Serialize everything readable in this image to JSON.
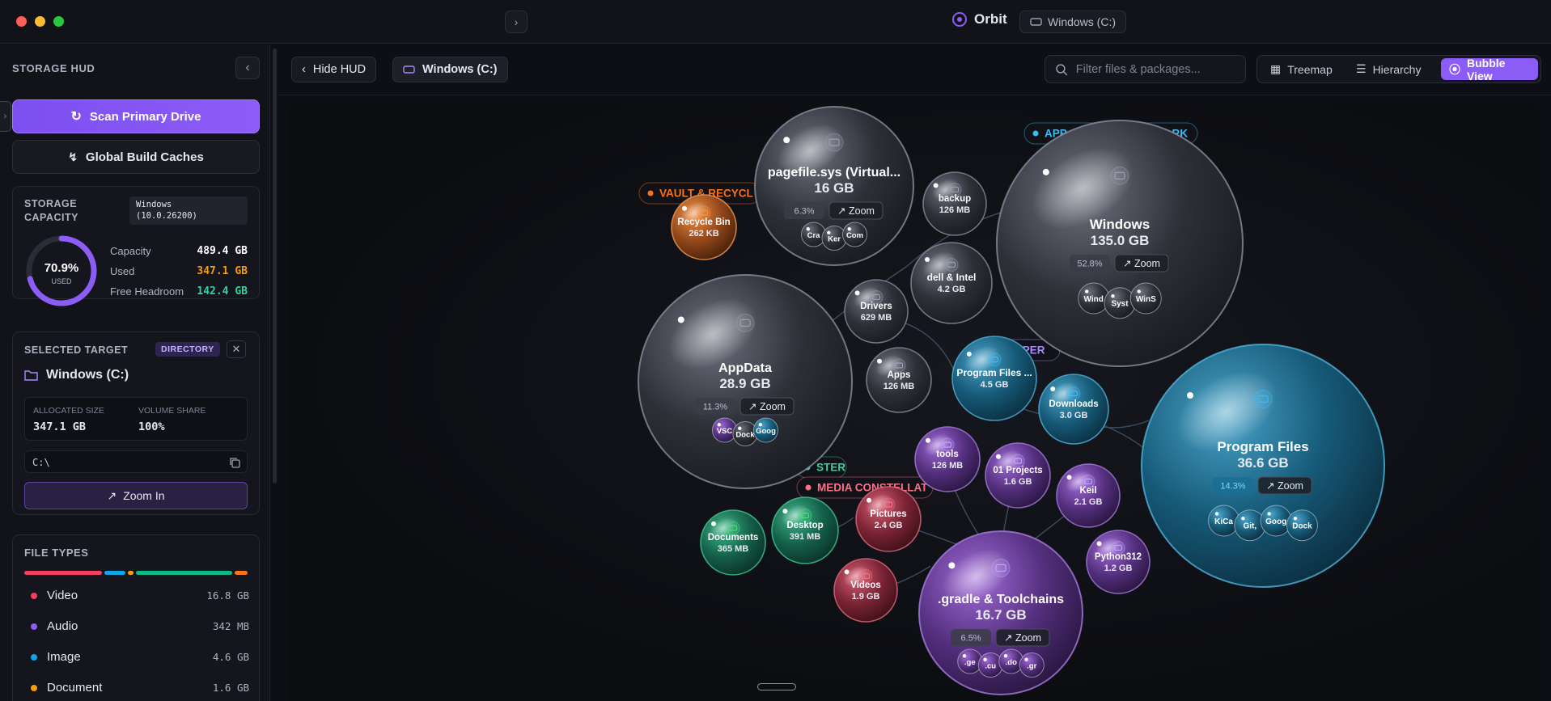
{
  "window": {
    "app_name": "Orbit",
    "drive_chip": "Windows (C:)"
  },
  "sidebar": {
    "title": "STORAGE HUD",
    "scan_button": "Scan Primary Drive",
    "caches_button": "Global Build Caches",
    "capacity_card": {
      "label": "STORAGE CAPACITY",
      "os_badge_line1": "Windows",
      "os_badge_line2": "(10.0.26200)",
      "gauge_value": "70.9%",
      "gauge_caption": "USED",
      "gauge_fraction": 0.709,
      "rows": [
        {
          "label": "Capacity",
          "value": "489.4 GB",
          "color": "#ffffff"
        },
        {
          "label": "Used",
          "value": "347.1 GB",
          "color": "#f59e0b"
        },
        {
          "label": "Free Headroom",
          "value": "142.4 GB",
          "color": "#34d399"
        }
      ]
    },
    "selected": {
      "label": "SELECTED TARGET",
      "badge": "DIRECTORY",
      "name": "Windows (C:)",
      "alloc_label": "ALLOCATED SIZE",
      "alloc_value": "347.1 GB",
      "share_label": "VOLUME SHARE",
      "share_value": "100%",
      "path": "C:\\",
      "zoom_button": "Zoom In"
    },
    "file_types": {
      "label": "FILE TYPES",
      "items": [
        {
          "name": "Video",
          "size": "16.8 GB",
          "color": "#f43f5e"
        },
        {
          "name": "Audio",
          "size": "342 MB",
          "color": "#8b5cf6"
        },
        {
          "name": "Image",
          "size": "4.6 GB",
          "color": "#0ea5e9"
        },
        {
          "name": "Document",
          "size": "1.6 GB",
          "color": "#f59e0b"
        }
      ]
    }
  },
  "toolbar": {
    "hide_hud": "Hide HUD",
    "crumb": "Windows (C:)",
    "search_placeholder": "Filter files & packages...",
    "views": [
      "Treemap",
      "Hierarchy",
      "Bubble View"
    ],
    "active_view": "Bubble View"
  },
  "clusters": [
    {
      "text": "VAULT & RECYCL",
      "color": "#f97316"
    },
    {
      "text": "APP",
      "suffix": "RK",
      "color": "#38bdf8"
    },
    {
      "text": "LOPER",
      "color": "#a78bfa"
    },
    {
      "text": "STER",
      "color": "#34d399"
    },
    {
      "text": "MEDIA CONSTELLAT",
      "color": "#fb7185"
    }
  ],
  "bubbles": [
    {
      "name": "pagefile.sys (Virtual...",
      "size": "16 GB",
      "share": "6.3%",
      "zoom": "Zoom",
      "children": [
        "Cra",
        "Ker",
        "Com"
      ],
      "theme": "gray"
    },
    {
      "name": "Windows",
      "size": "135.0 GB",
      "share": "52.8%",
      "zoom": "Zoom",
      "children": [
        "Wind",
        "Syst",
        "WinS"
      ],
      "theme": "gray"
    },
    {
      "name": "AppData",
      "size": "28.9 GB",
      "share": "11.3%",
      "zoom": "Zoom",
      "children": [
        "VSC",
        "Dock",
        "Goog"
      ],
      "theme": "gray"
    },
    {
      "name": "Program Files",
      "size": "36.6 GB",
      "share": "14.3%",
      "zoom": "Zoom",
      "children": [
        "KiCa",
        "Git,",
        "Goog",
        "Dock"
      ],
      "theme": "blue"
    },
    {
      "name": ".gradle & Toolchains",
      "size": "16.7 GB",
      "share": "6.5%",
      "zoom": "Zoom",
      "children": [
        ".ge",
        ".cu",
        ".do",
        ".gr"
      ],
      "theme": "purple"
    },
    {
      "name": "Recycle Bin",
      "size": "262 KB",
      "theme": "orange"
    },
    {
      "name": "backup",
      "size": "126 MB",
      "theme": "gray"
    },
    {
      "name": "dell & Intel",
      "size": "4.2 GB",
      "theme": "gray"
    },
    {
      "name": "Drivers",
      "size": "629 MB",
      "theme": "gray"
    },
    {
      "name": "Apps",
      "size": "126 MB",
      "theme": "gray"
    },
    {
      "name": "Program Files ...",
      "size": "4.5 GB",
      "theme": "blue"
    },
    {
      "name": "Downloads",
      "size": "3.0 GB",
      "theme": "blue"
    },
    {
      "name": "tools",
      "size": "126 MB",
      "theme": "purple"
    },
    {
      "name": "01 Projects",
      "size": "1.6 GB",
      "theme": "purple"
    },
    {
      "name": "Keil",
      "size": "2.1 GB",
      "theme": "purple"
    },
    {
      "name": "Python312",
      "size": "1.2 GB",
      "theme": "purple"
    },
    {
      "name": "Documents",
      "size": "365 MB",
      "theme": "green"
    },
    {
      "name": "Desktop",
      "size": "391 MB",
      "theme": "green"
    },
    {
      "name": "Pictures",
      "size": "2.4 GB",
      "theme": "red"
    },
    {
      "name": "Videos",
      "size": "1.9 GB",
      "theme": "red"
    }
  ]
}
